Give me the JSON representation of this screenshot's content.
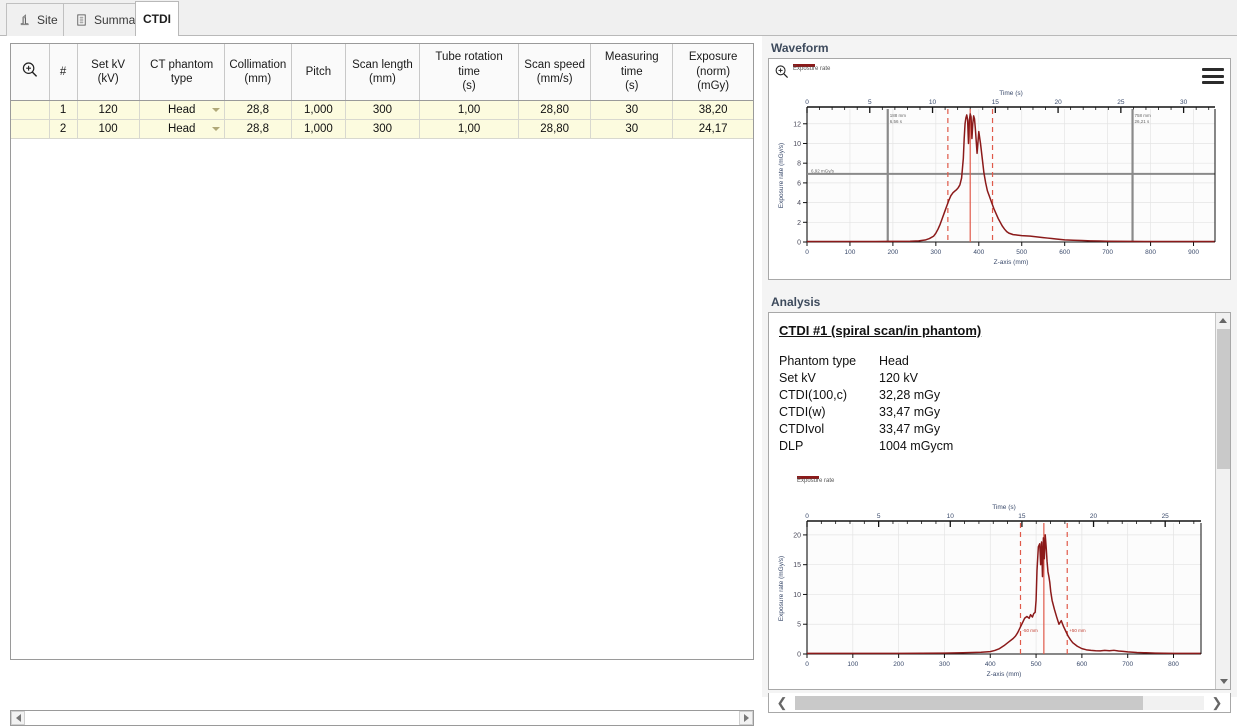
{
  "tabs": [
    {
      "label": "Site",
      "icon": "site-icon",
      "active": false
    },
    {
      "label": "Summary",
      "icon": "document-icon",
      "active": false
    },
    {
      "label": "CTDI",
      "icon": "none",
      "active": true
    }
  ],
  "table": {
    "zoom_icon": "magnifier-plus-icon",
    "headers": [
      {
        "l1": "#",
        "l2": "",
        "l3": ""
      },
      {
        "l1": "Set kV",
        "l2": "(kV)",
        "l3": ""
      },
      {
        "l1": "CT phantom",
        "l2": "type",
        "l3": ""
      },
      {
        "l1": "Collimation",
        "l2": "(mm)",
        "l3": ""
      },
      {
        "l1": "Pitch",
        "l2": "",
        "l3": ""
      },
      {
        "l1": "Scan length",
        "l2": "(mm)",
        "l3": ""
      },
      {
        "l1": "Tube rotation",
        "l2": "time",
        "l3": "(s)"
      },
      {
        "l1": "Scan speed",
        "l2": "(mm/s)",
        "l3": ""
      },
      {
        "l1": "Measuring time",
        "l2": "(s)",
        "l3": ""
      },
      {
        "l1": "Exposure",
        "l2": "(norm)",
        "l3": "(mGy)"
      }
    ],
    "rows": [
      {
        "num": "1",
        "set_kv": "120",
        "phantom": "Head",
        "collimation": "28,8",
        "pitch": "1,000",
        "scan_length": "300",
        "rotation_time": "1,00",
        "scan_speed": "28,80",
        "measuring_time": "30",
        "exposure": "38,20"
      },
      {
        "num": "2",
        "set_kv": "100",
        "phantom": "Head",
        "collimation": "28,8",
        "pitch": "1,000",
        "scan_length": "300",
        "rotation_time": "1,00",
        "scan_speed": "28,80",
        "measuring_time": "30",
        "exposure": "24,17"
      }
    ]
  },
  "waveform": {
    "title": "Waveform",
    "legend_label": "Exposure rate",
    "menu_icon": "hamburger-menu-icon",
    "zoom_icon": "magnifier-plus-icon",
    "marker_left": {
      "line1": "188 mm",
      "line2": "6,56 s"
    },
    "marker_right": {
      "line1": "758 mm",
      "line2": "26,21 s"
    },
    "threshold_label": "6,92 mGy/s"
  },
  "analysis": {
    "title": "Analysis",
    "heading": "CTDI #1 (spiral scan/in phantom)",
    "items": [
      {
        "key": "Phantom type",
        "value": "Head"
      },
      {
        "key": "Set kV",
        "value": "120 kV"
      },
      {
        "key": "CTDI(100,c)",
        "value": "32,28 mGy"
      },
      {
        "key": "CTDI(w)",
        "value": "33,47 mGy"
      },
      {
        "key": "CTDIvol",
        "value": "33,47 mGy"
      },
      {
        "key": "DLP",
        "value": "1004 mGycm"
      }
    ],
    "legend_label": "Exposure rate",
    "marker_minus": "-50 mm",
    "marker_plus": "+50 mm"
  },
  "chart_data": [
    {
      "id": "waveform-chart",
      "type": "line",
      "title": "",
      "xlabel": "Z-axis (mm)",
      "ylabel": "Exposure rate (mGy/s)",
      "top_axis_label": "Time (s)",
      "xlim": [
        0,
        950
      ],
      "ylim": [
        0,
        13.5
      ],
      "xticks": [
        0,
        100,
        200,
        300,
        400,
        500,
        600,
        700,
        800,
        900
      ],
      "top_ticks": [
        0,
        5,
        10,
        15,
        20,
        25,
        30
      ],
      "yticks": [
        0,
        2,
        4,
        6,
        8,
        10,
        12
      ],
      "grid": true,
      "legend": [
        "Exposure rate"
      ],
      "series_color": "#8b1a1a",
      "threshold_line": 6.92,
      "vertical_markers_mm": [
        188,
        758
      ],
      "dashed_markers_mm": [
        328,
        432
      ],
      "solid_marker_mm": 380,
      "x": [
        0,
        40,
        80,
        120,
        160,
        200,
        240,
        260,
        275,
        285,
        295,
        300,
        305,
        310,
        315,
        320,
        325,
        330,
        335,
        340,
        345,
        348,
        352,
        356,
        360,
        364,
        366,
        368,
        370,
        372,
        374,
        376,
        378,
        380,
        382,
        384,
        386,
        388,
        390,
        392,
        396,
        400,
        404,
        408,
        412,
        416,
        420,
        425,
        430,
        435,
        440,
        445,
        450,
        455,
        460,
        465,
        470,
        480,
        490,
        500,
        510,
        520,
        530,
        540,
        550,
        560,
        570,
        580,
        600,
        620,
        640,
        660,
        680,
        700,
        750,
        800,
        850,
        900,
        950
      ],
      "y": [
        0.05,
        0.05,
        0.05,
        0.05,
        0.05,
        0.06,
        0.08,
        0.12,
        0.2,
        0.35,
        0.6,
        0.9,
        1.3,
        1.8,
        2.4,
        3.0,
        3.6,
        4.2,
        4.7,
        5.0,
        5.2,
        5.3,
        5.5,
        5.8,
        6.5,
        8.5,
        10.5,
        12.0,
        12.6,
        12.9,
        12.4,
        10.0,
        12.3,
        13.0,
        12.7,
        10.5,
        12.0,
        12.8,
        12.5,
        11.5,
        9.0,
        11.2,
        10.0,
        8.5,
        7.0,
        6.0,
        5.2,
        4.6,
        4.0,
        3.4,
        2.9,
        2.4,
        2.0,
        1.6,
        1.3,
        1.05,
        0.9,
        0.75,
        0.7,
        0.65,
        0.62,
        0.6,
        0.55,
        0.5,
        0.45,
        0.4,
        0.35,
        0.3,
        0.22,
        0.18,
        0.15,
        0.12,
        0.1,
        0.08,
        0.06,
        0.05,
        0.05,
        0.05,
        0.05
      ]
    },
    {
      "id": "analysis-chart",
      "type": "line",
      "title": "",
      "xlabel": "Z-axis (mm)",
      "ylabel": "Exposure rate (mGy/s)",
      "top_axis_label": "Time (s)",
      "xlim": [
        0,
        860
      ],
      "ylim": [
        0,
        22
      ],
      "xticks": [
        0,
        100,
        200,
        300,
        400,
        500,
        600,
        700,
        800
      ],
      "top_ticks": [
        0,
        5,
        10,
        15,
        20,
        25
      ],
      "yticks": [
        0,
        5,
        10,
        15,
        20
      ],
      "grid": true,
      "legend": [
        "Exposure rate"
      ],
      "series_color": "#8b1a1a",
      "dashed_markers_mm": [
        466,
        568
      ],
      "solid_marker_mm": 517,
      "x": [
        0,
        50,
        100,
        150,
        200,
        250,
        300,
        340,
        360,
        380,
        400,
        410,
        420,
        430,
        440,
        450,
        455,
        460,
        465,
        470,
        475,
        480,
        485,
        488,
        492,
        495,
        498,
        500,
        502,
        505,
        508,
        510,
        512,
        514,
        516,
        518,
        520,
        522,
        524,
        526,
        528,
        530,
        532,
        535,
        540,
        545,
        550,
        555,
        560,
        565,
        570,
        575,
        580,
        590,
        600,
        610,
        620,
        630,
        640,
        650,
        660,
        670,
        680,
        690,
        700,
        720,
        740,
        760,
        780,
        800,
        830,
        860
      ],
      "y": [
        0.1,
        0.1,
        0.1,
        0.1,
        0.1,
        0.12,
        0.15,
        0.2,
        0.25,
        0.3,
        0.4,
        0.6,
        0.9,
        1.4,
        2.0,
        2.6,
        3.0,
        3.6,
        4.4,
        5.2,
        6.0,
        6.3,
        6.0,
        6.6,
        6.2,
        6.8,
        7.0,
        9.0,
        14.0,
        18.0,
        18.5,
        15.0,
        18.8,
        13.0,
        19.5,
        16.0,
        20.0,
        18.0,
        15.5,
        13.8,
        13.0,
        12.0,
        10.5,
        9.0,
        7.5,
        6.2,
        5.0,
        5.6,
        4.6,
        3.8,
        3.0,
        2.4,
        1.9,
        1.3,
        0.9,
        0.7,
        0.6,
        0.55,
        0.52,
        0.6,
        0.55,
        0.62,
        0.5,
        0.45,
        0.35,
        0.25,
        0.2,
        0.15,
        0.12,
        0.1,
        0.1,
        0.1
      ]
    }
  ]
}
